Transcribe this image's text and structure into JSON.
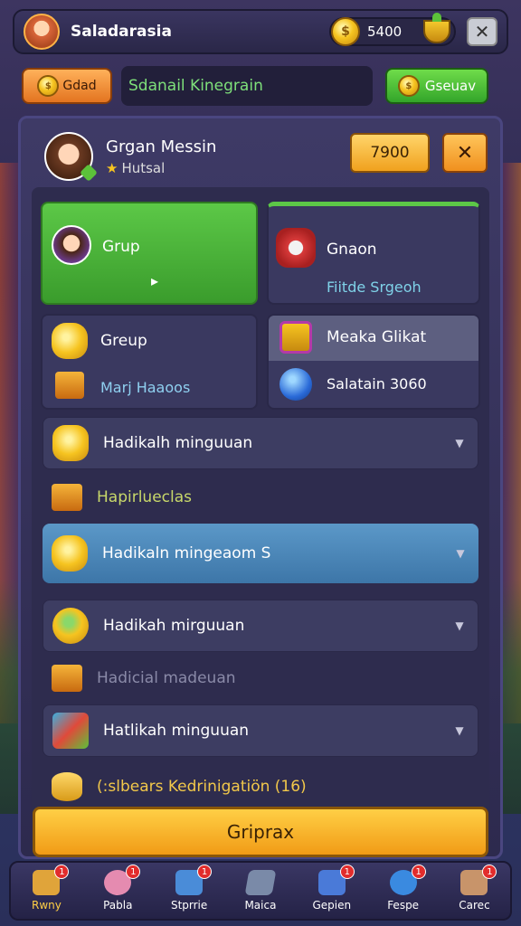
{
  "topbar": {
    "title": "Saladarasia",
    "coins": "5400",
    "coin_symbol": "$"
  },
  "bar2": {
    "left_button": "Gdad",
    "field_text": "Sdanail Kinegrain",
    "right_button": "Gseuav"
  },
  "profile": {
    "name": "Grgan Messin",
    "subtitle": "Hutsal",
    "score": "7900",
    "close": "✕"
  },
  "cards": [
    {
      "label": "Grup",
      "sub": "▸"
    },
    {
      "label": "Gnaon",
      "sub": "Fiitde Srgeoh"
    },
    {
      "label": "Greup",
      "sub": "Marj Haaoos"
    },
    {
      "label": "Meaka Glikat",
      "sub": "Salatain 3060"
    }
  ],
  "rows": [
    {
      "text": "Hadikalh minguuan",
      "type": "box",
      "chevron": "▼"
    },
    {
      "text": "Hapirlueclas",
      "type": "plain"
    },
    {
      "text": "Hadikaln mingeaom S",
      "type": "blue",
      "chevron": "▼"
    },
    {
      "text": "Hadikah mirguuan",
      "type": "box",
      "chevron": "▼"
    },
    {
      "text": "Hadicial madeuan",
      "type": "plain"
    },
    {
      "text": "Hatlikah minguuan",
      "type": "box",
      "chevron": "▼"
    },
    {
      "text": "(:slbears Kedrinigatiön (16)",
      "type": "plain"
    }
  ],
  "main_button": "Griprax",
  "nav": [
    {
      "label": "Rwny",
      "badge": "1",
      "color": "#e0a43a"
    },
    {
      "label": "Pabla",
      "badge": "1",
      "color": "#e58bb0"
    },
    {
      "label": "Stprrie",
      "badge": "1",
      "color": "#4a8cd8"
    },
    {
      "label": "Maica",
      "badge": "",
      "color": "#7a8aa8"
    },
    {
      "label": "Gepien",
      "badge": "1",
      "color": "#4a7ad8"
    },
    {
      "label": "Fespe",
      "badge": "1",
      "color": "#3a8ae0"
    },
    {
      "label": "Carec",
      "badge": "1",
      "color": "#c8946a"
    }
  ]
}
